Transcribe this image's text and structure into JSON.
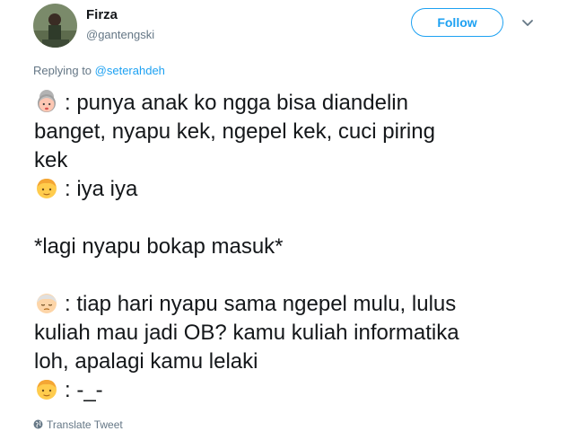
{
  "user": {
    "display_name": "Firza",
    "handle": "@gantengski"
  },
  "follow_button": {
    "label": "Follow"
  },
  "reply": {
    "prefix": "Replying to ",
    "mention": "@seterahdeh"
  },
  "tweet": {
    "lines": [
      {
        "emoji": "grandmother-emoji",
        "text": ": punya anak ko ngga bisa diandelin"
      },
      {
        "emoji": "",
        "text": "banget, nyapu kek, ngepel kek, cuci piring"
      },
      {
        "emoji": "",
        "text": "kek"
      },
      {
        "emoji": "boy-emoji",
        "text": ": iya iya"
      },
      {
        "emoji": "",
        "text": ""
      },
      {
        "emoji": "",
        "text": "*lagi nyapu bokap masuk*"
      },
      {
        "emoji": "",
        "text": ""
      },
      {
        "emoji": "old-man-emoji",
        "text": ": tiap hari nyapu sama ngepel mulu, lulus"
      },
      {
        "emoji": "",
        "text": "kuliah mau jadi OB? kamu kuliah informatika"
      },
      {
        "emoji": "",
        "text": "loh, apalagi kamu lelaki"
      },
      {
        "emoji": "boy-emoji",
        "text": ": -_-"
      }
    ]
  },
  "translate": {
    "label": "Translate Tweet",
    "icon": "globe-icon"
  },
  "colors": {
    "accent": "#1da1f2",
    "secondary_text": "#657786",
    "primary_text": "#14171a"
  }
}
